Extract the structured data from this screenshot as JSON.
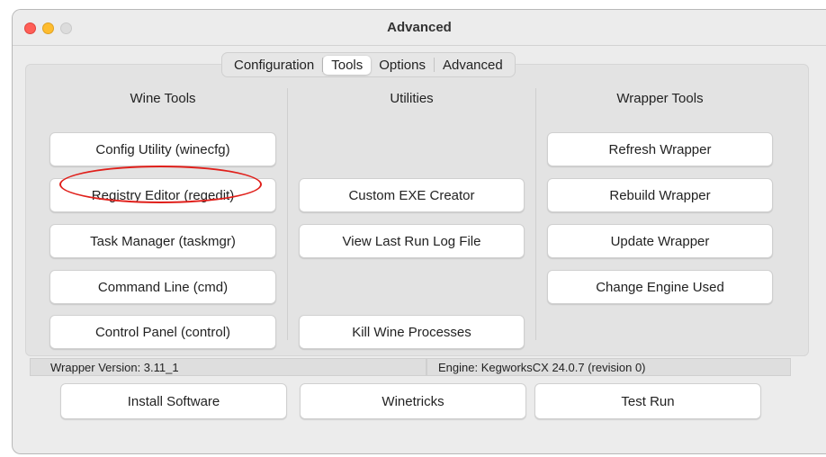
{
  "window": {
    "title": "Advanced"
  },
  "tabs": [
    {
      "label": "Configuration",
      "selected": false
    },
    {
      "label": "Tools",
      "selected": true
    },
    {
      "label": "Options",
      "selected": false
    },
    {
      "label": "Advanced",
      "selected": false
    }
  ],
  "columns": {
    "wine_tools": {
      "header": "Wine Tools",
      "buttons": [
        "Config Utility (winecfg)",
        "Registry Editor (regedit)",
        "Task Manager (taskmgr)",
        "Command Line (cmd)",
        "Control Panel (control)"
      ]
    },
    "utilities": {
      "header": "Utilities",
      "buttons": [
        "Custom EXE Creator",
        "View Last Run Log File",
        "Kill Wine Processes"
      ]
    },
    "wrapper_tools": {
      "header": "Wrapper Tools",
      "buttons": [
        "Refresh Wrapper",
        "Rebuild Wrapper",
        "Update Wrapper",
        "Change Engine Used"
      ]
    }
  },
  "status": {
    "wrapper_version": "Wrapper Version:  3.11_1",
    "engine": "Engine: KegworksCX 24.0.7 (revision 0)"
  },
  "bottom_buttons": {
    "install": "Install Software",
    "winetricks": "Winetricks",
    "test_run": "Test Run"
  },
  "colors": {
    "highlight_ring": "#e0201b",
    "close_button": "#ff5f57",
    "minimize_button": "#febc2e"
  },
  "icons": [
    "close-traffic-light",
    "minimize-traffic-light",
    "zoom-traffic-light"
  ]
}
